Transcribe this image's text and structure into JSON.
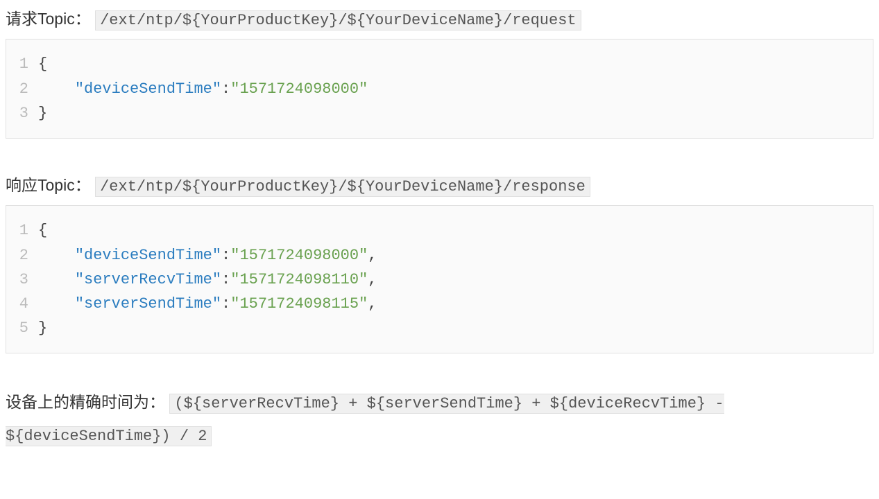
{
  "request": {
    "label": "请求Topic：",
    "topic_code": "/ext/ntp/${YourProductKey}/${YourDeviceName}/request",
    "code": {
      "line1_brace": "{",
      "line2_key": "\"deviceSendTime\"",
      "line2_colon": ":",
      "line2_val": "\"1571724098000\"",
      "line3_brace": "}"
    }
  },
  "response": {
    "label": "响应Topic：",
    "topic_code": "/ext/ntp/${YourProductKey}/${YourDeviceName}/response",
    "code": {
      "l1": "{",
      "l2_key": "\"deviceSendTime\"",
      "l2_val": "\"1571724098000\"",
      "l3_key": "\"serverRecvTime\"",
      "l3_val": "\"1571724098110\"",
      "l4_key": "\"serverSendTime\"",
      "l4_val": "\"1571724098115\"",
      "l5": "}",
      "colon": ":",
      "comma": ","
    }
  },
  "formula": {
    "label": "设备上的精确时间为：",
    "code": "(${serverRecvTime} + ${serverSendTime} + ${deviceRecvTime} - ${deviceSendTime}) / 2"
  },
  "linenos": {
    "n1": "1",
    "n2": "2",
    "n3": "3",
    "n4": "4",
    "n5": "5"
  }
}
